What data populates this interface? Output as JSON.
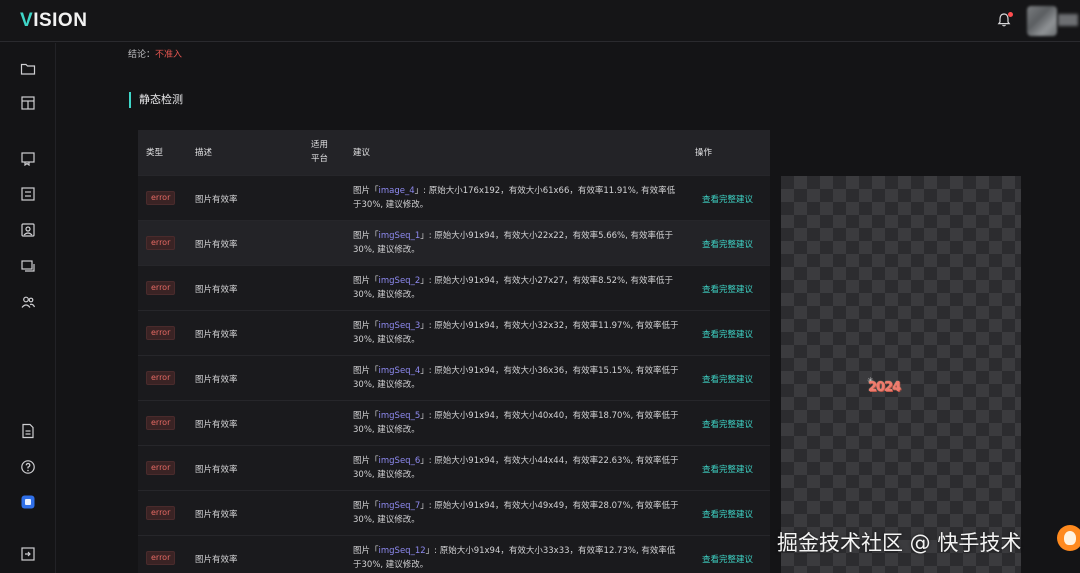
{
  "app": {
    "logo_first": "V",
    "logo_rest": "ISION"
  },
  "conclusion": {
    "label": "结论：",
    "value": "不准入"
  },
  "section": {
    "title": "静态检测"
  },
  "table": {
    "headers": {
      "type": "类型",
      "desc": "描述",
      "platform_line1": "适用",
      "platform_line2": "平台",
      "suggestion": "建议",
      "action": "操作"
    },
    "rows": [
      {
        "type": "error",
        "desc": "图片有效率",
        "prefix": "图片「",
        "name": "image_4",
        "mid": "」: 原始大小176x192，有效大小61x66，有效率11.91%, 有效率低于30%, 建议修改。",
        "action": "查看完整建议"
      },
      {
        "type": "error",
        "desc": "图片有效率",
        "prefix": "图片「",
        "name": "imgSeq_1",
        "mid": "」: 原始大小91x94，有效大小22x22，有效率5.66%, 有效率低于30%, 建议修改。",
        "action": "查看完整建议"
      },
      {
        "type": "error",
        "desc": "图片有效率",
        "prefix": "图片「",
        "name": "imgSeq_2",
        "mid": "」: 原始大小91x94，有效大小27x27，有效率8.52%, 有效率低于30%, 建议修改。",
        "action": "查看完整建议"
      },
      {
        "type": "error",
        "desc": "图片有效率",
        "prefix": "图片「",
        "name": "imgSeq_3",
        "mid": "」: 原始大小91x94，有效大小32x32，有效率11.97%, 有效率低于30%, 建议修改。",
        "action": "查看完整建议"
      },
      {
        "type": "error",
        "desc": "图片有效率",
        "prefix": "图片「",
        "name": "imgSeq_4",
        "mid": "」: 原始大小91x94，有效大小36x36，有效率15.15%, 有效率低于30%, 建议修改。",
        "action": "查看完整建议"
      },
      {
        "type": "error",
        "desc": "图片有效率",
        "prefix": "图片「",
        "name": "imgSeq_5",
        "mid": "」: 原始大小91x94，有效大小40x40，有效率18.70%, 有效率低于30%, 建议修改。",
        "action": "查看完整建议"
      },
      {
        "type": "error",
        "desc": "图片有效率",
        "prefix": "图片「",
        "name": "imgSeq_6",
        "mid": "」: 原始大小91x94，有效大小44x44，有效率22.63%, 有效率低于30%, 建议修改。",
        "action": "查看完整建议"
      },
      {
        "type": "error",
        "desc": "图片有效率",
        "prefix": "图片「",
        "name": "imgSeq_7",
        "mid": "」: 原始大小91x94，有效大小49x49，有效率28.07%, 有效率低于30%, 建议修改。",
        "action": "查看完整建议"
      },
      {
        "type": "error",
        "desc": "图片有效率",
        "prefix": "图片「",
        "name": "imgSeq_12",
        "mid": "」: 原始大小91x94，有效大小33x33，有效率12.73%, 有效率低于30%, 建议修改。",
        "action": "查看完整建议"
      }
    ]
  },
  "preview": {
    "art_text": "2024"
  },
  "watermark": {
    "text": "掘金技术社区 @ 快手技术"
  },
  "colors": {
    "accent": "#3fd6c8",
    "error": "#e36963",
    "link": "#8e8af0",
    "background": "#141416"
  },
  "icons": {
    "top": [
      "bell-icon",
      "avatar"
    ],
    "sidebar": [
      "folder-icon",
      "layout-icon",
      "bookmark-icon",
      "form-icon",
      "image-icon",
      "layers-icon",
      "users-icon",
      "document-icon",
      "help-icon",
      "app-badge-icon",
      "logout-icon"
    ]
  }
}
